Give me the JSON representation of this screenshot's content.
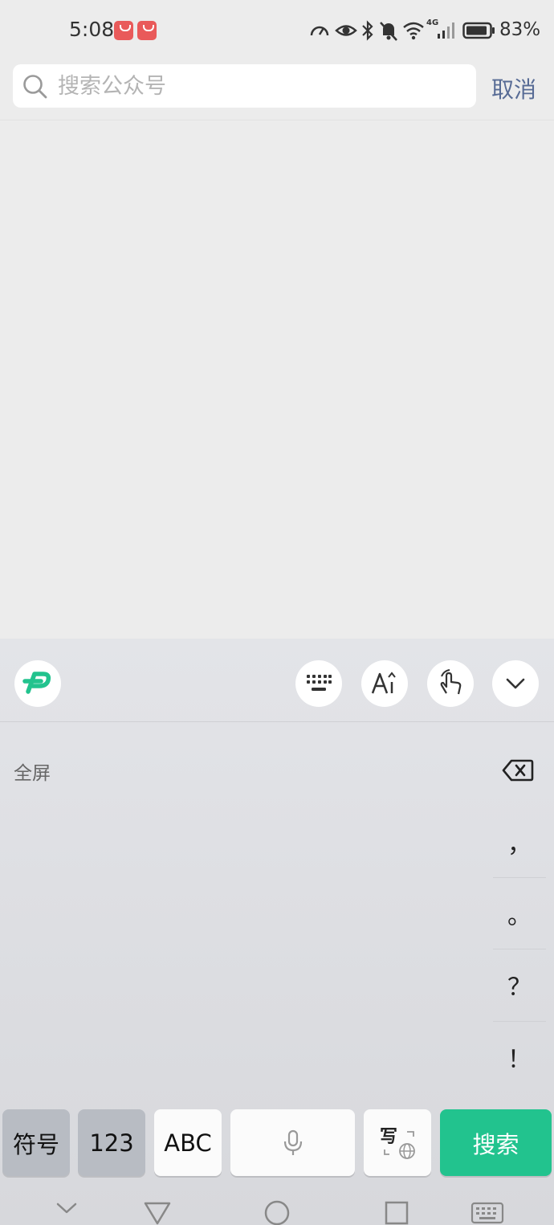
{
  "status_bar": {
    "time": "5:08",
    "battery": "83%",
    "network": "4G"
  },
  "search": {
    "placeholder": "搜索公众号",
    "value": "",
    "cancel_label": "取消"
  },
  "keyboard": {
    "toolbar_icons": [
      "logo-icon",
      "keyboard-icon",
      "font-size-icon",
      "gesture-icon",
      "collapse-chevron-icon"
    ],
    "fullscreen_label": "全屏",
    "punctuation": [
      "，",
      "。",
      "？",
      "！"
    ],
    "bottom_keys": {
      "symbols": "符号",
      "numbers": "123",
      "abc": "ABC",
      "handwrite": "写",
      "search": "搜索"
    },
    "accent_color": "#22c38e"
  },
  "nav_bar": {
    "icons": [
      "hide-keyboard-chevron-icon",
      "back-triangle-icon",
      "home-circle-icon",
      "recents-square-icon",
      "keyboard-switch-icon"
    ]
  }
}
